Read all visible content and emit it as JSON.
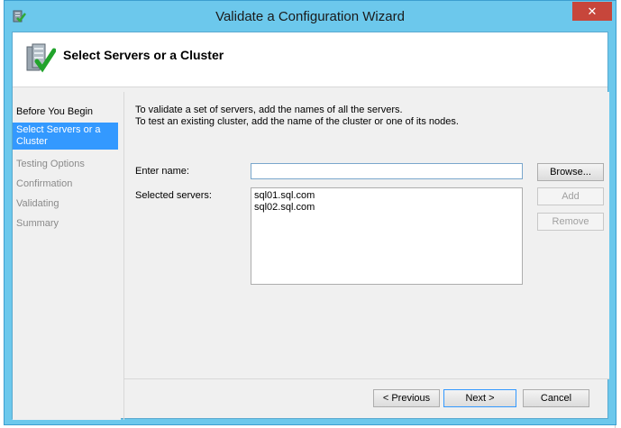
{
  "window": {
    "title": "Validate a Configuration Wizard",
    "close_label": "✕"
  },
  "header": {
    "title": "Select Servers or a Cluster"
  },
  "nav": {
    "items": [
      {
        "label": "Before You Begin",
        "state": "done"
      },
      {
        "label": "Select Servers or a Cluster",
        "state": "active"
      },
      {
        "label": "Testing Options",
        "state": "pending"
      },
      {
        "label": "Confirmation",
        "state": "pending"
      },
      {
        "label": "Validating",
        "state": "pending"
      },
      {
        "label": "Summary",
        "state": "pending"
      }
    ]
  },
  "content": {
    "intro_line1": "To validate a set of servers, add the names of all the servers.",
    "intro_line2": "To test an existing cluster, add the name of the cluster or one of its nodes.",
    "enter_name_label": "Enter name:",
    "enter_name_value": "",
    "selected_servers_label": "Selected servers:",
    "selected_servers": [
      "sql01.sql.com",
      "sql02.sql.com"
    ],
    "browse_label": "Browse...",
    "add_label": "Add",
    "remove_label": "Remove"
  },
  "footer": {
    "previous_label": "< Previous",
    "next_label": "Next >",
    "cancel_label": "Cancel"
  },
  "colors": {
    "frame": "#6cc8ec",
    "close": "#c7463b",
    "selection": "#3399ff"
  }
}
